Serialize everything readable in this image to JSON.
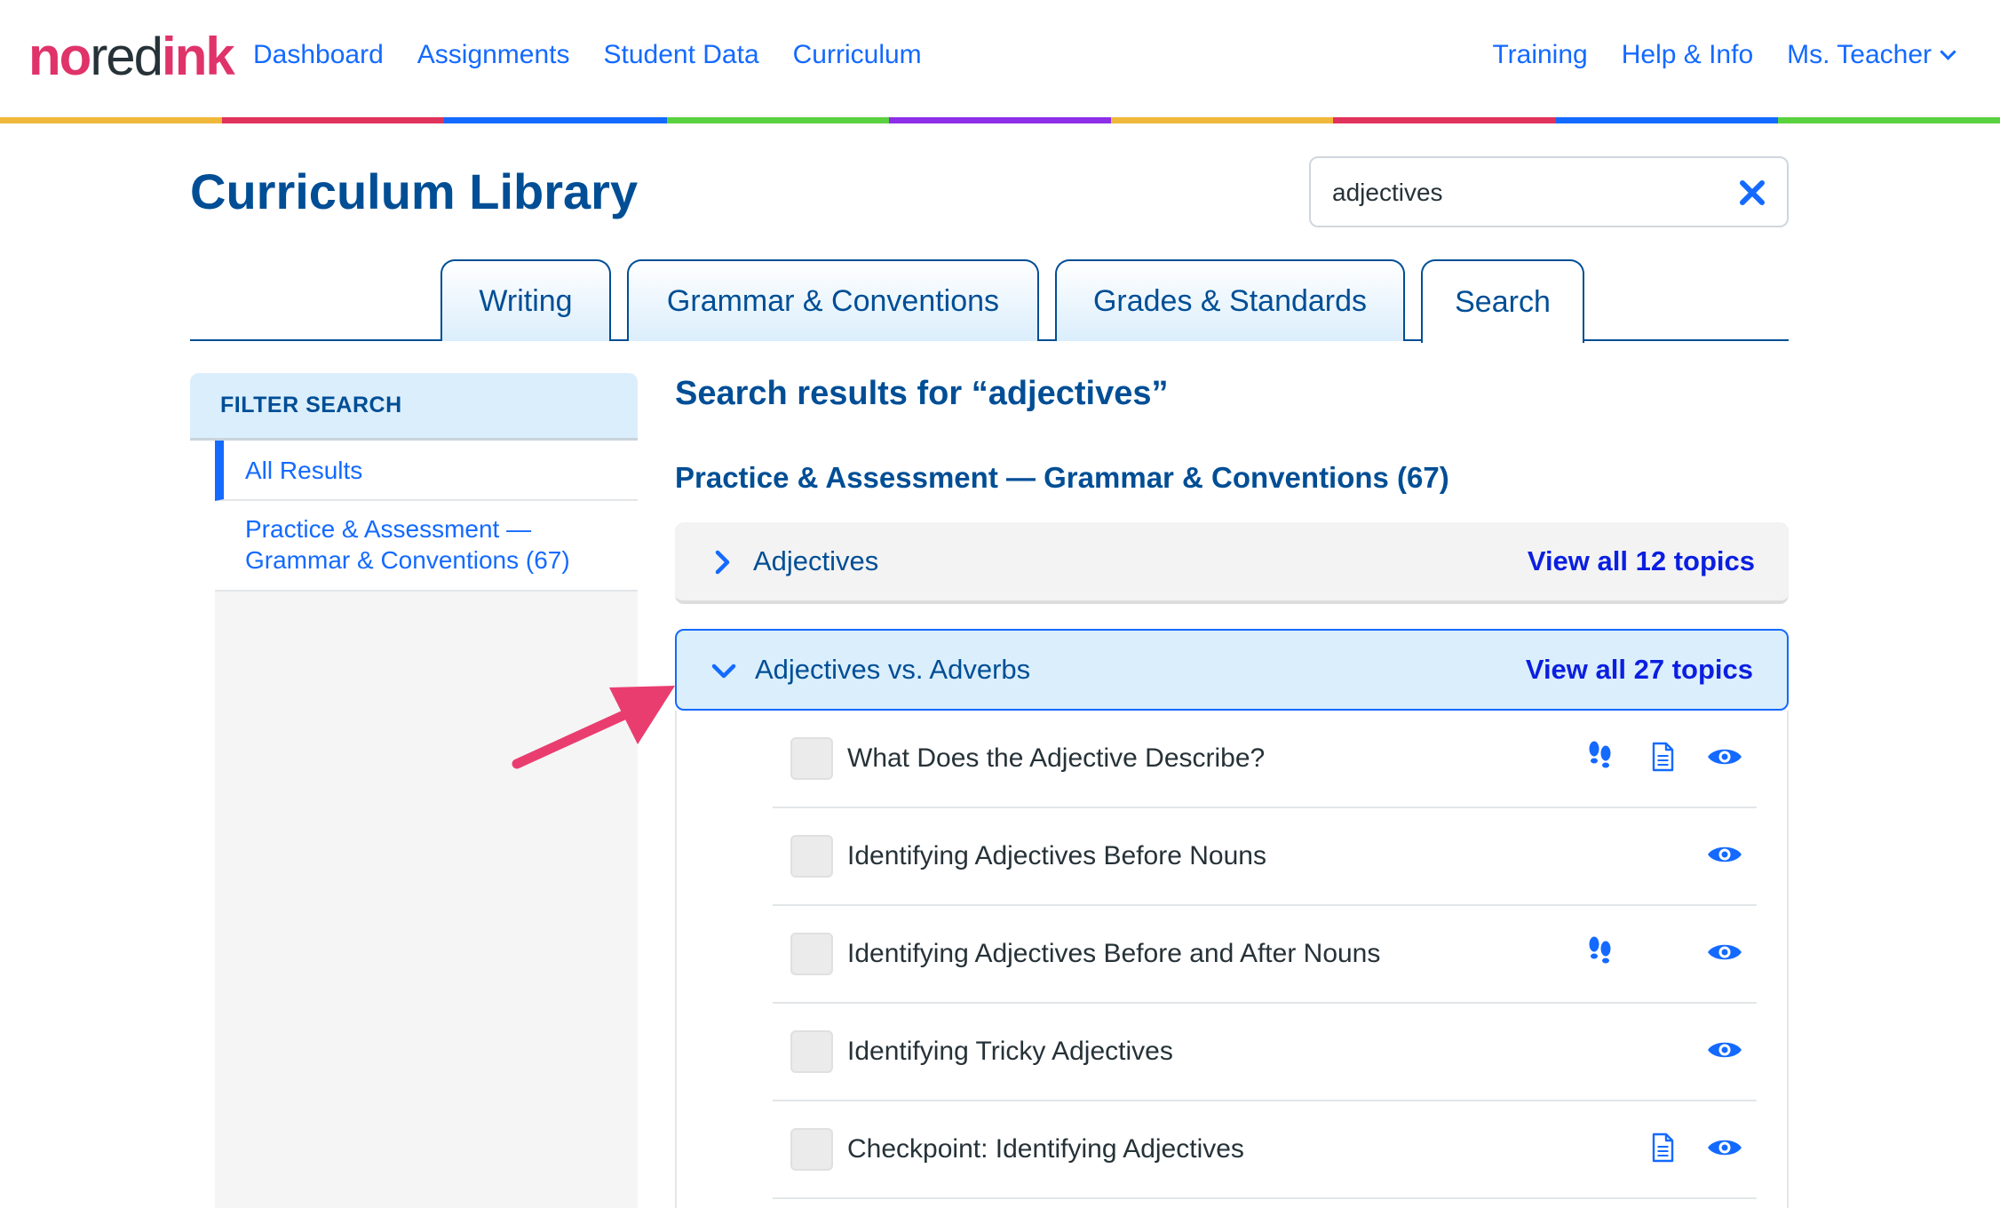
{
  "brand": {
    "part1": "no",
    "part2": "red",
    "part3": "ink"
  },
  "nav": {
    "left": [
      "Dashboard",
      "Assignments",
      "Student Data",
      "Curriculum"
    ],
    "right": [
      "Training",
      "Help & Info"
    ],
    "user": "Ms. Teacher"
  },
  "rainbow_colors": [
    "#f0b83a",
    "#e0335c",
    "#146aff",
    "#5ad13f",
    "#8c2fe6",
    "#f0b83a",
    "#e0335c",
    "#146aff",
    "#5ad13f"
  ],
  "page": {
    "title": "Curriculum Library"
  },
  "search": {
    "value": "adjectives",
    "placeholder": ""
  },
  "tabs": [
    {
      "label": "Writing",
      "active": false
    },
    {
      "label": "Grammar & Conventions",
      "active": false
    },
    {
      "label": "Grades & Standards",
      "active": false
    },
    {
      "label": "Search",
      "active": true
    }
  ],
  "sidebar": {
    "header": "FILTER SEARCH",
    "items": [
      {
        "label": "All Results",
        "active": true
      },
      {
        "label_line1": "Practice & Assessment —",
        "label_line2": "Grammar & Conventions (67)",
        "active": false
      }
    ]
  },
  "results": {
    "title": "Search results for “adjectives”",
    "section_title": "Practice & Assessment — Grammar & Conventions (67)",
    "groups": [
      {
        "label": "Adjectives",
        "view_all": "View all 12 topics",
        "expanded": false
      },
      {
        "label": "Adjectives vs. Adverbs",
        "view_all": "View all 27 topics",
        "expanded": true
      }
    ],
    "topics": [
      {
        "label": "What Does the Adjective Describe?",
        "icons": [
          "footsteps-icon",
          "document-icon",
          "eye-icon"
        ]
      },
      {
        "label": "Identifying Adjectives Before Nouns",
        "icons": [
          "eye-icon"
        ]
      },
      {
        "label": "Identifying Adjectives Before and After Nouns",
        "icons": [
          "footsteps-icon",
          "eye-icon"
        ]
      },
      {
        "label": "Identifying Tricky Adjectives",
        "icons": [
          "eye-icon"
        ]
      },
      {
        "label": "Checkpoint: Identifying Adjectives",
        "icons": [
          "document-icon",
          "eye-icon"
        ]
      }
    ]
  },
  "colors": {
    "brand_pink": "#e0336a",
    "navy": "#004e95",
    "link_blue": "#146aff",
    "annotation_arrow": "#ea3d6f"
  }
}
